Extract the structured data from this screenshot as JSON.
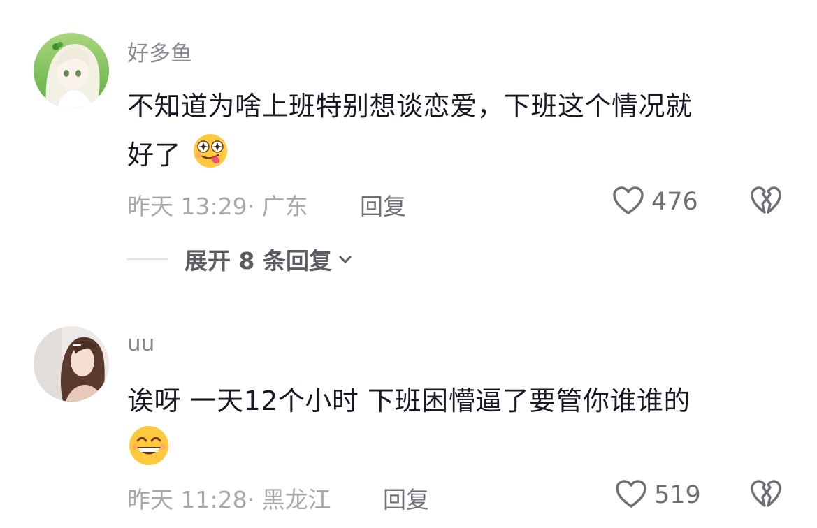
{
  "comments": [
    {
      "username": "好多鱼",
      "text_lines": [
        "不知道为啥上班特别想谈恋爱，下班这个情况就",
        "好了"
      ],
      "emoji": "tongue-out-star-eyes-emoji",
      "time": "昨天 13:29",
      "location_separator": "·",
      "location": "广东",
      "reply_label": "回复",
      "like_count": "476",
      "expand": {
        "label": "展开 8 条回复"
      }
    },
    {
      "username": "uu",
      "text_lines": [
        "诶呀 一天12个小时 下班困懵逼了要管你谁谁的"
      ],
      "emoji": "grinning-emoji",
      "time": "昨天 11:28",
      "location_separator": "·",
      "location": "黑龙江",
      "reply_label": "回复",
      "like_count": "519"
    }
  ],
  "icons": {
    "like": "heart-outline-icon",
    "dislike": "broken-heart-icon",
    "expand": "chevron-down-icon"
  },
  "colors": {
    "username": "#8a8b91",
    "text": "#161823",
    "meta": "#a8a9ad",
    "action": "#6f7077",
    "emoji_face": "#ffc83d"
  }
}
